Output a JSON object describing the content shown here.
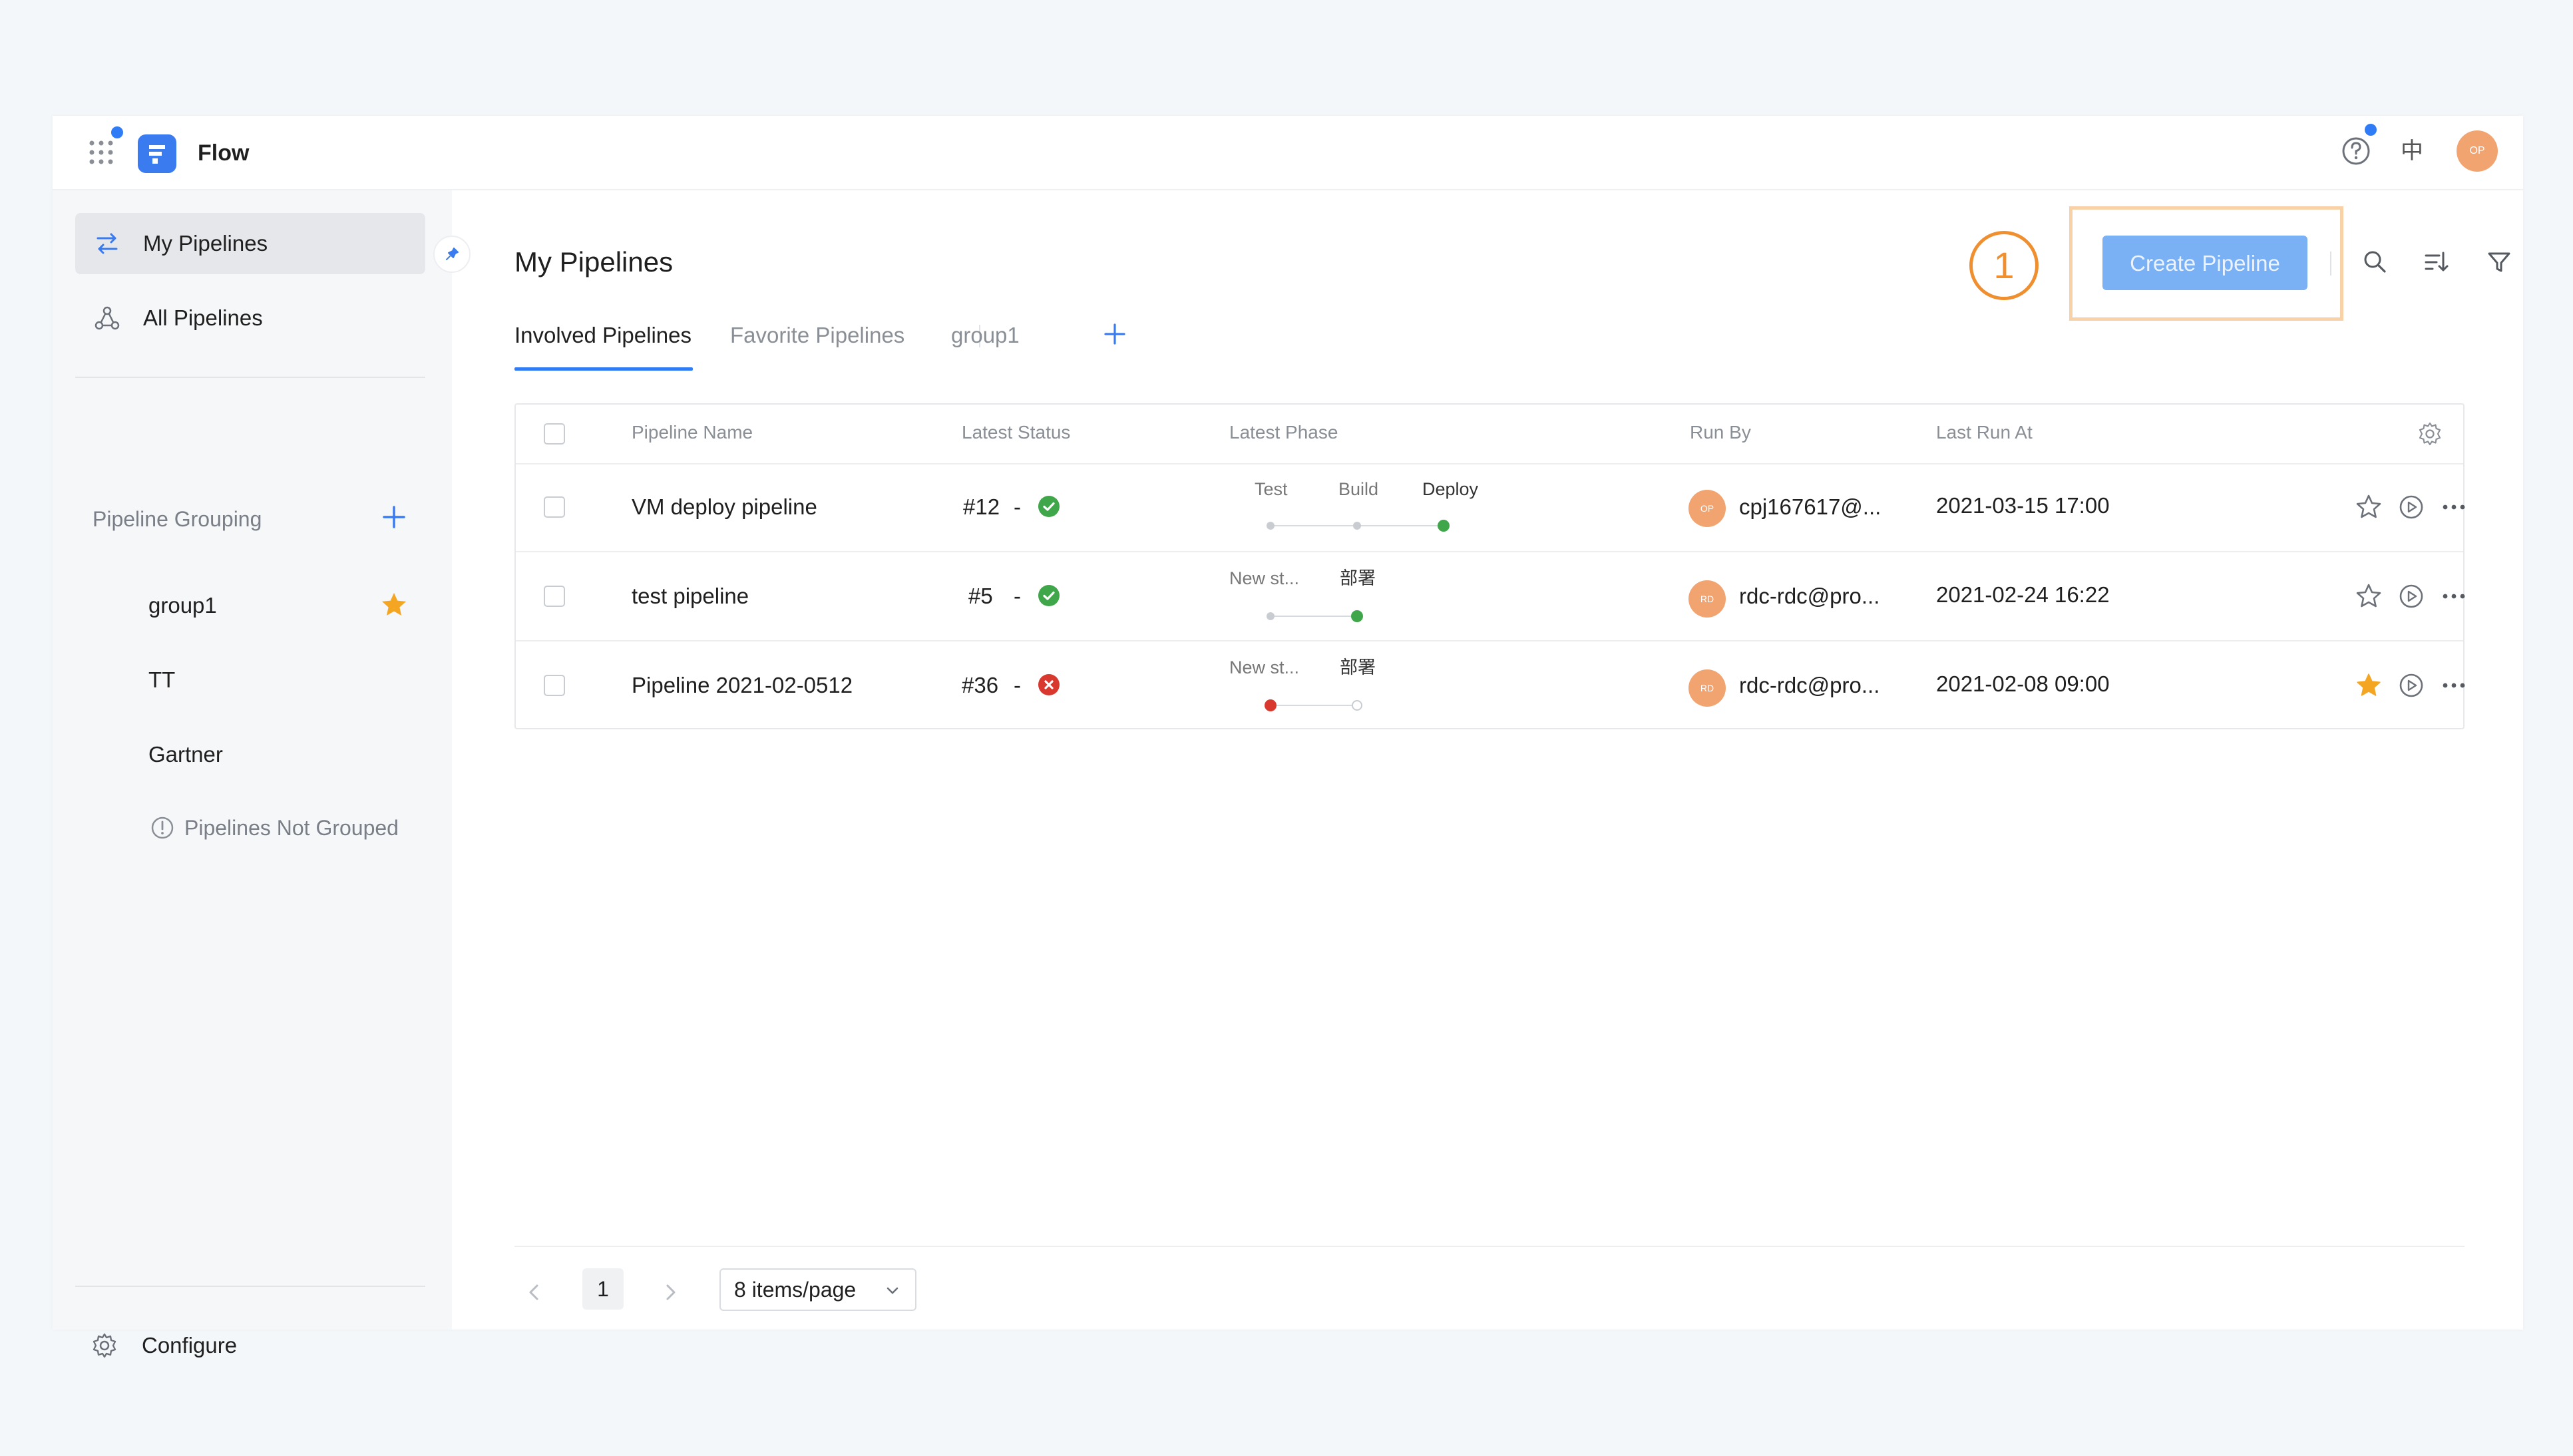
{
  "topbar": {
    "app_name": "Flow",
    "lang": "中",
    "avatar_initials": "OP",
    "accent": "#2f7cf6"
  },
  "sidebar": {
    "nav": [
      {
        "label": "My Pipelines",
        "icon": "swap-icon",
        "active": true
      },
      {
        "label": "All Pipelines",
        "icon": "nodes-icon",
        "active": false
      }
    ],
    "grouping_title": "Pipeline Grouping",
    "groups": [
      {
        "label": "group1",
        "starred": true
      },
      {
        "label": "TT",
        "starred": false
      },
      {
        "label": "Gartner",
        "starred": false
      }
    ],
    "ungrouped_label": "Pipelines Not Grouped",
    "configure_label": "Configure"
  },
  "main": {
    "title": "My Pipelines",
    "tabs": [
      {
        "label": "Involved Pipelines",
        "active": true
      },
      {
        "label": "Favorite Pipelines",
        "active": false
      },
      {
        "label": "group1",
        "active": false
      }
    ],
    "step_number": "1",
    "create_label": "Create Pipeline",
    "columns": [
      "Pipeline Name",
      "Latest Status",
      "Latest Phase",
      "Run By",
      "Last Run At"
    ],
    "rows": [
      {
        "name": "VM deploy pipeline",
        "run": "#12",
        "sep": "-",
        "status": "success",
        "phases": [
          "Test",
          "Build",
          "Deploy"
        ],
        "run_by_initials": "OP",
        "run_by": "cpj167617@...",
        "last_run": "2021-03-15 17:00",
        "favorite": false
      },
      {
        "name": "test pipeline",
        "run": "#5",
        "sep": "-",
        "status": "success",
        "phases": [
          "New st...",
          "部署"
        ],
        "run_by_initials": "RD",
        "run_by": "rdc-rdc@pro...",
        "last_run": "2021-02-24 16:22",
        "favorite": false
      },
      {
        "name": "Pipeline 2021-02-0512",
        "run": "#36",
        "sep": "-",
        "status": "failed",
        "phases": [
          "New st...",
          "部署"
        ],
        "run_by_initials": "RD",
        "run_by": "rdc-rdc@pro...",
        "last_run": "2021-02-08 09:00",
        "favorite": true
      }
    ]
  },
  "pagination": {
    "current_page": "1",
    "page_size_label": "8 items/page"
  },
  "colors": {
    "success": "#3fa74a",
    "failed": "#d9382e",
    "star": "#f4a623",
    "highlight": "#ef8f2f"
  }
}
